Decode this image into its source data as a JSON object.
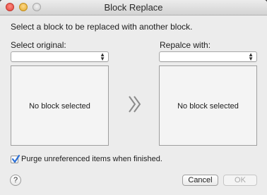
{
  "window": {
    "title": "Block Replace"
  },
  "dialog": {
    "instruction": "Select a block to be replaced with another block.",
    "original_label": "Select original:",
    "original_value": "",
    "replacement_label": "Repalce with:",
    "replacement_value": "",
    "original_preview_text": "No block selected",
    "replacement_preview_text": "No block selected",
    "arrow_icon": "double-chevron-right-icon",
    "purge_label": "Purge unreferenced items when finished.",
    "purge_checked": true,
    "help_label": "?",
    "cancel_label": "Cancel",
    "ok_label": "OK"
  },
  "colors": {
    "window_bg": "#ececec",
    "close_button": "#e0443b",
    "minimize_button": "#e0a92a",
    "checkmark": "#2a6fd6",
    "disabled_text": "#a9a9a9"
  }
}
